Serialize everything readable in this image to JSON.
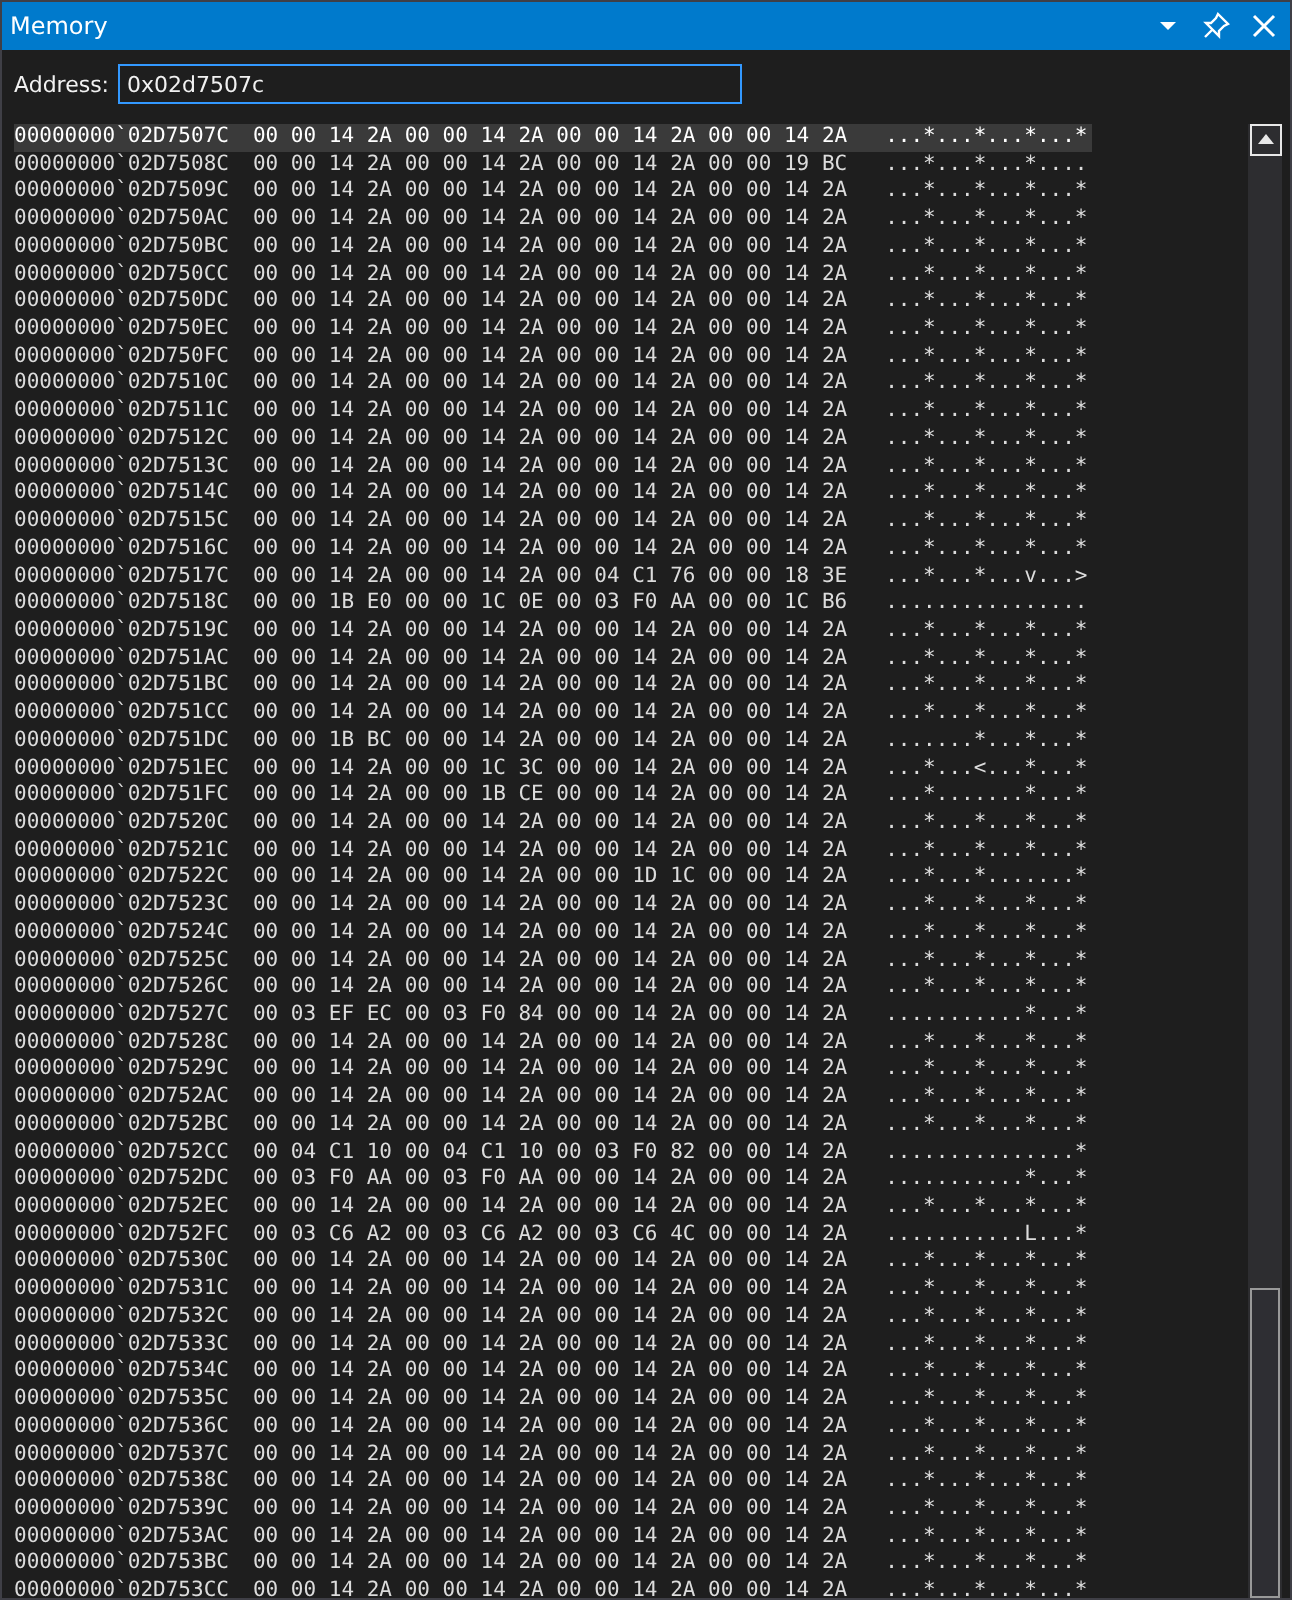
{
  "window": {
    "title": "Memory"
  },
  "address": {
    "label": "Address:",
    "value": "0x02d7507c"
  },
  "rows": [
    {
      "address": "00000000`02D7507C",
      "hex": "00 00 14 2A 00 00 14 2A 00 00 14 2A 00 00 14 2A",
      "ascii": "...*...*...*...*",
      "selected": true
    },
    {
      "address": "00000000`02D7508C",
      "hex": "00 00 14 2A 00 00 14 2A 00 00 14 2A 00 00 19 BC",
      "ascii": "...*...*...*....",
      "selected": false
    },
    {
      "address": "00000000`02D7509C",
      "hex": "00 00 14 2A 00 00 14 2A 00 00 14 2A 00 00 14 2A",
      "ascii": "...*...*...*...*",
      "selected": false
    },
    {
      "address": "00000000`02D750AC",
      "hex": "00 00 14 2A 00 00 14 2A 00 00 14 2A 00 00 14 2A",
      "ascii": "...*...*...*...*",
      "selected": false
    },
    {
      "address": "00000000`02D750BC",
      "hex": "00 00 14 2A 00 00 14 2A 00 00 14 2A 00 00 14 2A",
      "ascii": "...*...*...*...*",
      "selected": false
    },
    {
      "address": "00000000`02D750CC",
      "hex": "00 00 14 2A 00 00 14 2A 00 00 14 2A 00 00 14 2A",
      "ascii": "...*...*...*...*",
      "selected": false
    },
    {
      "address": "00000000`02D750DC",
      "hex": "00 00 14 2A 00 00 14 2A 00 00 14 2A 00 00 14 2A",
      "ascii": "...*...*...*...*",
      "selected": false
    },
    {
      "address": "00000000`02D750EC",
      "hex": "00 00 14 2A 00 00 14 2A 00 00 14 2A 00 00 14 2A",
      "ascii": "...*...*...*...*",
      "selected": false
    },
    {
      "address": "00000000`02D750FC",
      "hex": "00 00 14 2A 00 00 14 2A 00 00 14 2A 00 00 14 2A",
      "ascii": "...*...*...*...*",
      "selected": false
    },
    {
      "address": "00000000`02D7510C",
      "hex": "00 00 14 2A 00 00 14 2A 00 00 14 2A 00 00 14 2A",
      "ascii": "...*...*...*...*",
      "selected": false
    },
    {
      "address": "00000000`02D7511C",
      "hex": "00 00 14 2A 00 00 14 2A 00 00 14 2A 00 00 14 2A",
      "ascii": "...*...*...*...*",
      "selected": false
    },
    {
      "address": "00000000`02D7512C",
      "hex": "00 00 14 2A 00 00 14 2A 00 00 14 2A 00 00 14 2A",
      "ascii": "...*...*...*...*",
      "selected": false
    },
    {
      "address": "00000000`02D7513C",
      "hex": "00 00 14 2A 00 00 14 2A 00 00 14 2A 00 00 14 2A",
      "ascii": "...*...*...*...*",
      "selected": false
    },
    {
      "address": "00000000`02D7514C",
      "hex": "00 00 14 2A 00 00 14 2A 00 00 14 2A 00 00 14 2A",
      "ascii": "...*...*...*...*",
      "selected": false
    },
    {
      "address": "00000000`02D7515C",
      "hex": "00 00 14 2A 00 00 14 2A 00 00 14 2A 00 00 14 2A",
      "ascii": "...*...*...*...*",
      "selected": false
    },
    {
      "address": "00000000`02D7516C",
      "hex": "00 00 14 2A 00 00 14 2A 00 00 14 2A 00 00 14 2A",
      "ascii": "...*...*...*...*",
      "selected": false
    },
    {
      "address": "00000000`02D7517C",
      "hex": "00 00 14 2A 00 00 14 2A 00 04 C1 76 00 00 18 3E",
      "ascii": "...*...*...v...>",
      "selected": false
    },
    {
      "address": "00000000`02D7518C",
      "hex": "00 00 1B E0 00 00 1C 0E 00 03 F0 AA 00 00 1C B6",
      "ascii": "................",
      "selected": false
    },
    {
      "address": "00000000`02D7519C",
      "hex": "00 00 14 2A 00 00 14 2A 00 00 14 2A 00 00 14 2A",
      "ascii": "...*...*...*...*",
      "selected": false
    },
    {
      "address": "00000000`02D751AC",
      "hex": "00 00 14 2A 00 00 14 2A 00 00 14 2A 00 00 14 2A",
      "ascii": "...*...*...*...*",
      "selected": false
    },
    {
      "address": "00000000`02D751BC",
      "hex": "00 00 14 2A 00 00 14 2A 00 00 14 2A 00 00 14 2A",
      "ascii": "...*...*...*...*",
      "selected": false
    },
    {
      "address": "00000000`02D751CC",
      "hex": "00 00 14 2A 00 00 14 2A 00 00 14 2A 00 00 14 2A",
      "ascii": "...*...*...*...*",
      "selected": false
    },
    {
      "address": "00000000`02D751DC",
      "hex": "00 00 1B BC 00 00 14 2A 00 00 14 2A 00 00 14 2A",
      "ascii": ".......*...*...*",
      "selected": false
    },
    {
      "address": "00000000`02D751EC",
      "hex": "00 00 14 2A 00 00 1C 3C 00 00 14 2A 00 00 14 2A",
      "ascii": "...*...<...*...*",
      "selected": false
    },
    {
      "address": "00000000`02D751FC",
      "hex": "00 00 14 2A 00 00 1B CE 00 00 14 2A 00 00 14 2A",
      "ascii": "...*.......*...*",
      "selected": false
    },
    {
      "address": "00000000`02D7520C",
      "hex": "00 00 14 2A 00 00 14 2A 00 00 14 2A 00 00 14 2A",
      "ascii": "...*...*...*...*",
      "selected": false
    },
    {
      "address": "00000000`02D7521C",
      "hex": "00 00 14 2A 00 00 14 2A 00 00 14 2A 00 00 14 2A",
      "ascii": "...*...*...*...*",
      "selected": false
    },
    {
      "address": "00000000`02D7522C",
      "hex": "00 00 14 2A 00 00 14 2A 00 00 1D 1C 00 00 14 2A",
      "ascii": "...*...*.......*",
      "selected": false
    },
    {
      "address": "00000000`02D7523C",
      "hex": "00 00 14 2A 00 00 14 2A 00 00 14 2A 00 00 14 2A",
      "ascii": "...*...*...*...*",
      "selected": false
    },
    {
      "address": "00000000`02D7524C",
      "hex": "00 00 14 2A 00 00 14 2A 00 00 14 2A 00 00 14 2A",
      "ascii": "...*...*...*...*",
      "selected": false
    },
    {
      "address": "00000000`02D7525C",
      "hex": "00 00 14 2A 00 00 14 2A 00 00 14 2A 00 00 14 2A",
      "ascii": "...*...*...*...*",
      "selected": false
    },
    {
      "address": "00000000`02D7526C",
      "hex": "00 00 14 2A 00 00 14 2A 00 00 14 2A 00 00 14 2A",
      "ascii": "...*...*...*...*",
      "selected": false
    },
    {
      "address": "00000000`02D7527C",
      "hex": "00 03 EF EC 00 03 F0 84 00 00 14 2A 00 00 14 2A",
      "ascii": "...........*...*",
      "selected": false
    },
    {
      "address": "00000000`02D7528C",
      "hex": "00 00 14 2A 00 00 14 2A 00 00 14 2A 00 00 14 2A",
      "ascii": "...*...*...*...*",
      "selected": false
    },
    {
      "address": "00000000`02D7529C",
      "hex": "00 00 14 2A 00 00 14 2A 00 00 14 2A 00 00 14 2A",
      "ascii": "...*...*...*...*",
      "selected": false
    },
    {
      "address": "00000000`02D752AC",
      "hex": "00 00 14 2A 00 00 14 2A 00 00 14 2A 00 00 14 2A",
      "ascii": "...*...*...*...*",
      "selected": false
    },
    {
      "address": "00000000`02D752BC",
      "hex": "00 00 14 2A 00 00 14 2A 00 00 14 2A 00 00 14 2A",
      "ascii": "...*...*...*...*",
      "selected": false
    },
    {
      "address": "00000000`02D752CC",
      "hex": "00 04 C1 10 00 04 C1 10 00 03 F0 82 00 00 14 2A",
      "ascii": "...............*",
      "selected": false
    },
    {
      "address": "00000000`02D752DC",
      "hex": "00 03 F0 AA 00 03 F0 AA 00 00 14 2A 00 00 14 2A",
      "ascii": "...........*...*",
      "selected": false
    },
    {
      "address": "00000000`02D752EC",
      "hex": "00 00 14 2A 00 00 14 2A 00 00 14 2A 00 00 14 2A",
      "ascii": "...*...*...*...*",
      "selected": false
    },
    {
      "address": "00000000`02D752FC",
      "hex": "00 03 C6 A2 00 03 C6 A2 00 03 C6 4C 00 00 14 2A",
      "ascii": "...........L...*",
      "selected": false
    },
    {
      "address": "00000000`02D7530C",
      "hex": "00 00 14 2A 00 00 14 2A 00 00 14 2A 00 00 14 2A",
      "ascii": "...*...*...*...*",
      "selected": false
    },
    {
      "address": "00000000`02D7531C",
      "hex": "00 00 14 2A 00 00 14 2A 00 00 14 2A 00 00 14 2A",
      "ascii": "...*...*...*...*",
      "selected": false
    },
    {
      "address": "00000000`02D7532C",
      "hex": "00 00 14 2A 00 00 14 2A 00 00 14 2A 00 00 14 2A",
      "ascii": "...*...*...*...*",
      "selected": false
    },
    {
      "address": "00000000`02D7533C",
      "hex": "00 00 14 2A 00 00 14 2A 00 00 14 2A 00 00 14 2A",
      "ascii": "...*...*...*...*",
      "selected": false
    },
    {
      "address": "00000000`02D7534C",
      "hex": "00 00 14 2A 00 00 14 2A 00 00 14 2A 00 00 14 2A",
      "ascii": "...*...*...*...*",
      "selected": false
    },
    {
      "address": "00000000`02D7535C",
      "hex": "00 00 14 2A 00 00 14 2A 00 00 14 2A 00 00 14 2A",
      "ascii": "...*...*...*...*",
      "selected": false
    },
    {
      "address": "00000000`02D7536C",
      "hex": "00 00 14 2A 00 00 14 2A 00 00 14 2A 00 00 14 2A",
      "ascii": "...*...*...*...*",
      "selected": false
    },
    {
      "address": "00000000`02D7537C",
      "hex": "00 00 14 2A 00 00 14 2A 00 00 14 2A 00 00 14 2A",
      "ascii": "...*...*...*...*",
      "selected": false
    },
    {
      "address": "00000000`02D7538C",
      "hex": "00 00 14 2A 00 00 14 2A 00 00 14 2A 00 00 14 2A",
      "ascii": "...*...*...*...*",
      "selected": false
    },
    {
      "address": "00000000`02D7539C",
      "hex": "00 00 14 2A 00 00 14 2A 00 00 14 2A 00 00 14 2A",
      "ascii": "...*...*...*...*",
      "selected": false
    },
    {
      "address": "00000000`02D753AC",
      "hex": "00 00 14 2A 00 00 14 2A 00 00 14 2A 00 00 14 2A",
      "ascii": "...*...*...*...*",
      "selected": false
    },
    {
      "address": "00000000`02D753BC",
      "hex": "00 00 14 2A 00 00 14 2A 00 00 14 2A 00 00 14 2A",
      "ascii": "...*...*...*...*",
      "selected": false
    },
    {
      "address": "00000000`02D753CC",
      "hex": "00 00 14 2A 00 00 14 2A 00 00 14 2A 00 00 14 2A",
      "ascii": "...*...*...*...*",
      "selected": false
    }
  ]
}
